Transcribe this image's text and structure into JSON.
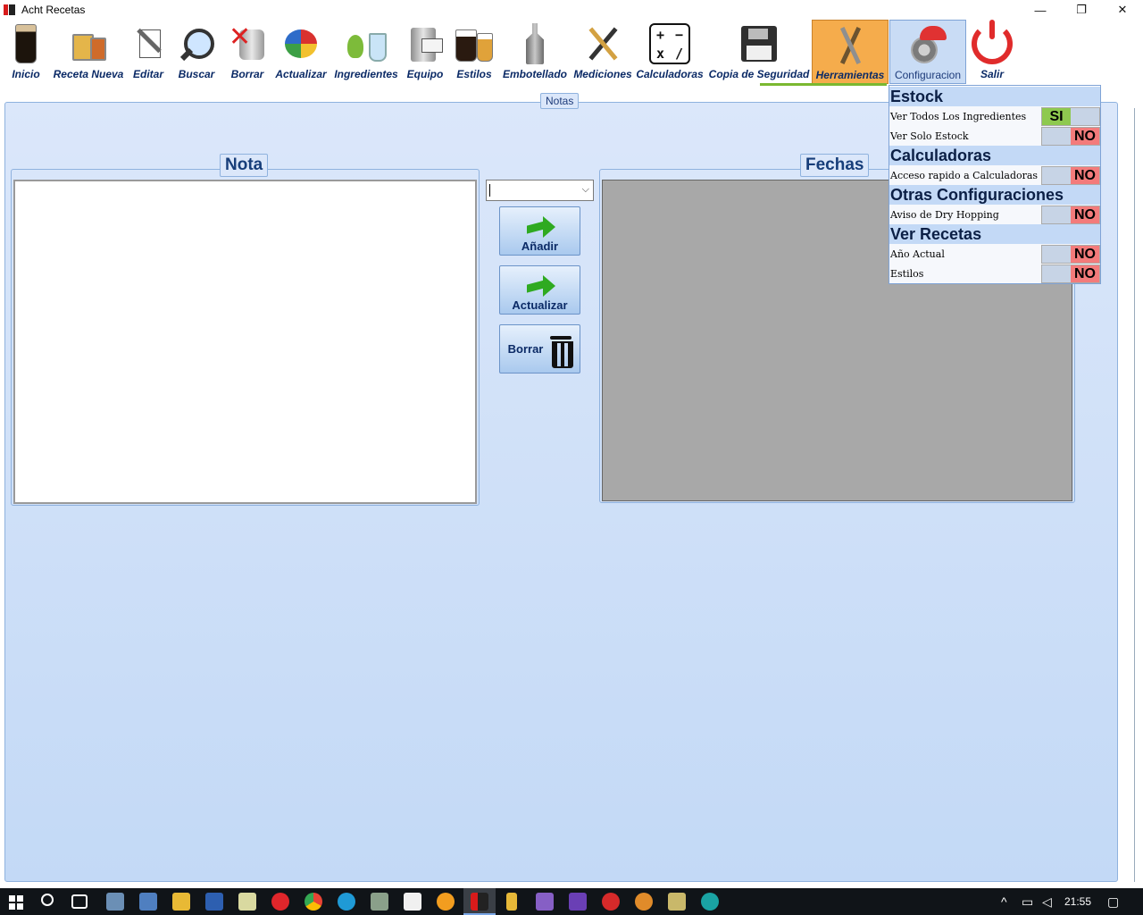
{
  "window": {
    "title": "Acht Recetas",
    "minimize": "—",
    "maximize": "❐",
    "close": "✕"
  },
  "toolbar": {
    "items": [
      {
        "label": "Inicio"
      },
      {
        "label": "Receta Nueva"
      },
      {
        "label": "Editar"
      },
      {
        "label": "Buscar"
      },
      {
        "label": "Borrar"
      },
      {
        "label": "Actualizar"
      },
      {
        "label": "Ingredientes"
      },
      {
        "label": "Equipo"
      },
      {
        "label": "Estilos"
      },
      {
        "label": "Embotellado"
      },
      {
        "label": "Mediciones"
      },
      {
        "label": "Calculadoras"
      },
      {
        "label": "Copia de Seguridad"
      },
      {
        "label": "Herramientas",
        "active": true
      },
      {
        "label": "Configuracion"
      },
      {
        "label": "Salir"
      }
    ],
    "calc_symbols": [
      "+",
      "−",
      "x",
      "/"
    ]
  },
  "main": {
    "tab_label": "Notas",
    "nota_title": "Nota",
    "fechas_title": "Fechas",
    "date_combo_value": "",
    "buttons": {
      "anadir": "Añadir",
      "actualizar": "Actualizar",
      "borrar": "Borrar"
    }
  },
  "config_menu": {
    "sections": [
      {
        "title": "Estock"
      },
      {
        "title": "Calculadoras"
      },
      {
        "title": "Otras Configuraciones"
      },
      {
        "title": "Ver Recetas"
      }
    ],
    "rows": [
      {
        "label": "Ver Todos Los Ingredientes",
        "state": "SI"
      },
      {
        "label": "Ver Solo Estock",
        "state": "NO"
      },
      {
        "label": "Acceso rapido a Calculadoras",
        "state": "NO"
      },
      {
        "label": "Aviso de Dry Hopping",
        "state": "NO"
      },
      {
        "label": "Año Actual",
        "state": "NO"
      },
      {
        "label": "Estilos",
        "state": "NO"
      }
    ]
  },
  "taskbar": {
    "time": "21:55"
  },
  "colors": {
    "accent_active": "#f5ac4c",
    "toggle_on": "#8ec94f",
    "toggle_off": "#f37b7b",
    "panel_bg": "#c3d9f6"
  }
}
